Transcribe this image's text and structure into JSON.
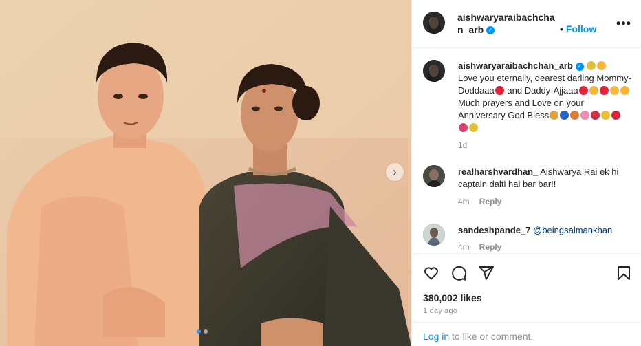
{
  "post": {
    "username": "aishwaryaraibachchan_arb",
    "follow_label": "Follow",
    "follow_separator": "•",
    "more_label": "•••",
    "carousel_next": "›"
  },
  "caption": {
    "username": "aishwaryaraibachchan_arb",
    "text_1": "Love you eternally, dearest darling Mommy-Doddaaa",
    "text_2": " and Daddy-Ajjaaa",
    "text_3": " Much prayers and Love on your Anniversary God Bless",
    "time": "1d"
  },
  "comments": [
    {
      "username": "realharshvardhan_",
      "text": "Aishwarya Rai ek hi captain dalti hai bar bar!!",
      "time": "4m",
      "reply_label": "Reply"
    },
    {
      "username": "sandeshpande_7",
      "text": "@beingsalmankhan",
      "time": "4m",
      "reply_label": "Reply"
    }
  ],
  "likes": "380,002 likes",
  "posted_ago": "1 day ago",
  "footer": {
    "login_link": "Log in",
    "login_rest": " to like or comment."
  },
  "icons": [
    "heart-icon",
    "comment-icon",
    "share-icon",
    "bookmark-icon",
    "verified-icon",
    "more-icon",
    "chevron-right-icon"
  ],
  "colors": {
    "accent": "#0095f6",
    "text": "#262626",
    "muted": "#8e8e8e",
    "photo_tone": "#e8c9a4"
  }
}
